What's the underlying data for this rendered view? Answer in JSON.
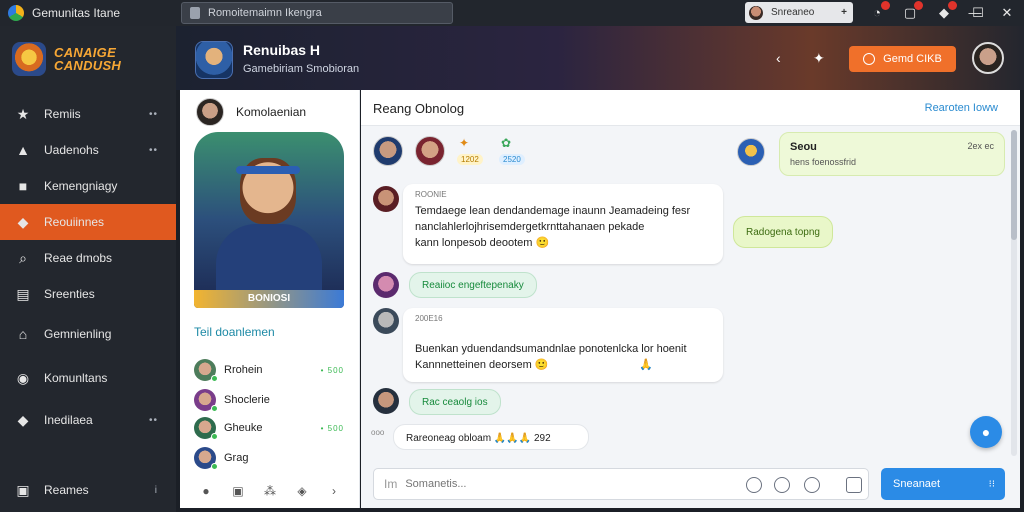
{
  "window": {
    "title": "Gemunitas Itane",
    "search_text": "Romoitemaimn Ikengra",
    "user_chip": "Snreaneo",
    "user_chip_plus": "+"
  },
  "sidebar": {
    "brand": "CANAIGE\nCANDUSH",
    "items": [
      {
        "label": "Remiis",
        "icon": "star",
        "more": "••"
      },
      {
        "label": "Uadenohs",
        "icon": "mountain",
        "more": "••"
      },
      {
        "label": "Kemengniagy",
        "icon": "square",
        "more": ""
      },
      {
        "label": "Reouiinnes",
        "icon": "flame",
        "more": "",
        "active": true
      },
      {
        "label": "Reae dmobs",
        "icon": "search",
        "more": ""
      },
      {
        "label": "Sreenties",
        "icon": "document",
        "more": ""
      },
      {
        "label": "Gemnienling",
        "icon": "home",
        "more": ""
      },
      {
        "label": "Komunltans",
        "icon": "avatar",
        "more": ""
      },
      {
        "label": "Inedilaea",
        "icon": "tag",
        "more": "••"
      },
      {
        "label": "Reames",
        "icon": "box",
        "more": "i"
      }
    ]
  },
  "header": {
    "game_name": "Renuibas H",
    "game_sub": "Gamebiriam Smobioran",
    "cta_label": "Gemd CIKB"
  },
  "left_panel": {
    "user_name": "Komolaenian",
    "hero_caption": "BONIOSI",
    "section_title": "Teil doanlemen",
    "friends": [
      {
        "name": "Rrohein",
        "status": "• 500",
        "color": "#4d7c5b"
      },
      {
        "name": "Shoclerie",
        "status": "",
        "color": "#7a3d8a"
      },
      {
        "name": "Gheuke",
        "status": "• 500",
        "color": "#2e6b4d"
      },
      {
        "name": "Grag",
        "status": "",
        "color": "#2b4a8a"
      }
    ]
  },
  "chat": {
    "title": "Reang Obnolog",
    "header_link": "Rearoten Ioww",
    "strip_tags": [
      "1202",
      "2520"
    ],
    "top_card": {
      "name": "Seou",
      "sub": "hens foenossfrid",
      "time": "2ex ec"
    },
    "messages": [
      {
        "meta": "ROONIE",
        "lines": [
          "Temdaege lean dendandemage inaunn Jeamadeing fesr",
          "nanclahlerlojhrisemdergetkrnttahanaen pekade",
          "kann lonpesob deootem 🙂"
        ]
      },
      {
        "pill": "Reaiioc engeftepenaky"
      },
      {
        "meta": "200E16",
        "lines": [
          "Buenkan yduendandsumandnlae ponotenlcka lor hoenit",
          "Kannnetteinen deorsem 🙂"
        ],
        "reaction": "🙏"
      },
      {
        "pill": "Rac ceaolg ios"
      },
      {
        "reaction_bar": "Rareoneag obloam 🙏🙏🙏 292",
        "prefix": "ooo"
      }
    ],
    "side_pill": "Radogena topng",
    "composer_prefix": "Im",
    "composer_placeholder": "Somanetis...",
    "send_label": "Sneanaet",
    "send_icon": "⁝⁝"
  }
}
